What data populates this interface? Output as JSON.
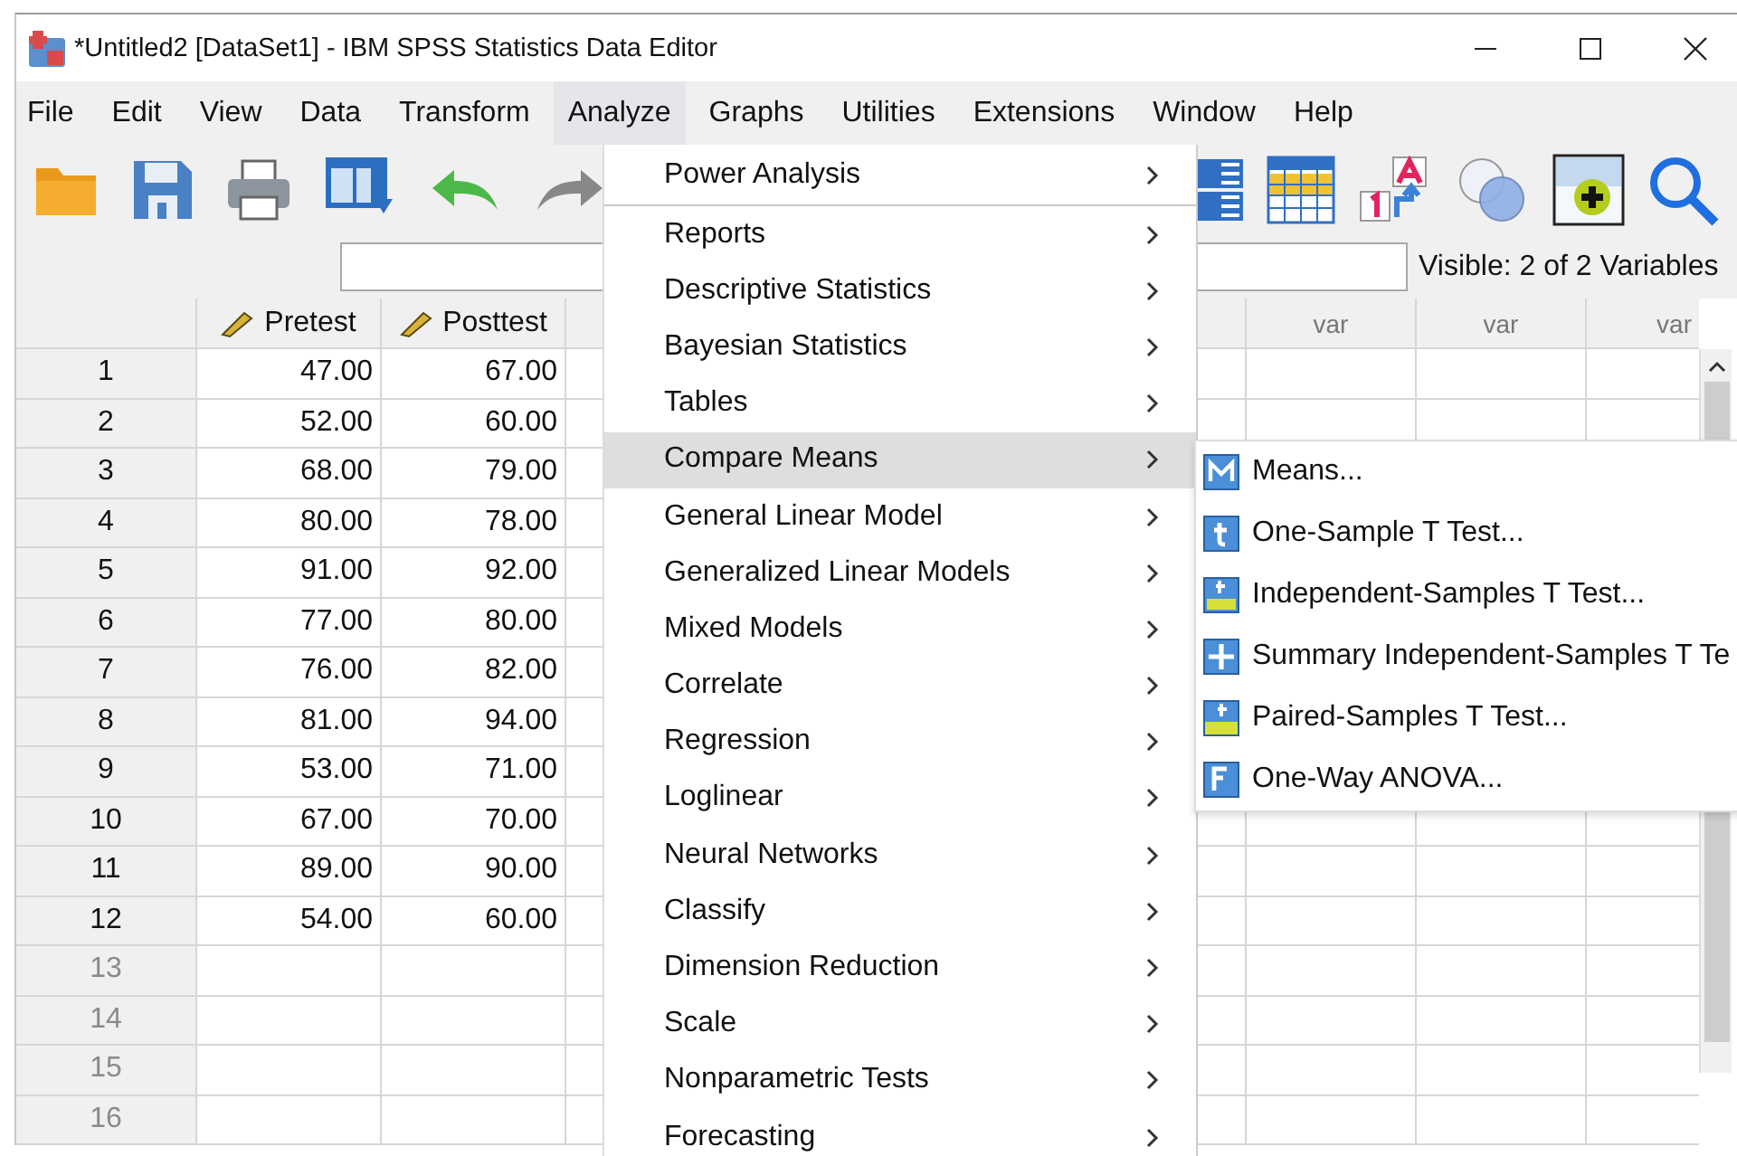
{
  "window": {
    "title": "*Untitled2 [DataSet1] - IBM SPSS Statistics Data Editor"
  },
  "menu_bar": [
    {
      "label": "File",
      "selected": false
    },
    {
      "label": "Edit",
      "selected": false
    },
    {
      "label": "View",
      "selected": false
    },
    {
      "label": "Data",
      "selected": false
    },
    {
      "label": "Transform",
      "selected": false
    },
    {
      "label": "Analyze",
      "selected": true
    },
    {
      "label": "Graphs",
      "selected": false
    },
    {
      "label": "Utilities",
      "selected": false
    },
    {
      "label": "Extensions",
      "selected": false
    },
    {
      "label": "Window",
      "selected": false
    },
    {
      "label": "Help",
      "selected": false
    }
  ],
  "variable_bar": {
    "status": "Visible: 2 of 2 Variables"
  },
  "grid": {
    "columns": [
      {
        "label": "Pretest"
      },
      {
        "label": "Posttest"
      }
    ],
    "var_columns": [
      "var",
      "var",
      "var"
    ],
    "rows": [
      {
        "number": "1",
        "values": [
          "47.00",
          "67.00"
        ]
      },
      {
        "number": "2",
        "values": [
          "52.00",
          "60.00"
        ]
      },
      {
        "number": "3",
        "values": [
          "68.00",
          "79.00"
        ]
      },
      {
        "number": "4",
        "values": [
          "80.00",
          "78.00"
        ]
      },
      {
        "number": "5",
        "values": [
          "91.00",
          "92.00"
        ]
      },
      {
        "number": "6",
        "values": [
          "77.00",
          "80.00"
        ]
      },
      {
        "number": "7",
        "values": [
          "76.00",
          "82.00"
        ]
      },
      {
        "number": "8",
        "values": [
          "81.00",
          "94.00"
        ]
      },
      {
        "number": "9",
        "values": [
          "53.00",
          "71.00"
        ]
      },
      {
        "number": "10",
        "values": [
          "67.00",
          "70.00"
        ]
      },
      {
        "number": "11",
        "values": [
          "89.00",
          "90.00"
        ]
      },
      {
        "number": "12",
        "values": [
          "54.00",
          "60.00"
        ]
      },
      {
        "number": "13"
      },
      {
        "number": "14"
      },
      {
        "number": "15"
      },
      {
        "number": "16"
      }
    ]
  },
  "analyze_menu": {
    "items": [
      {
        "label": "Power Analysis",
        "selected": false,
        "separator_after": true
      },
      {
        "label": "Reports",
        "selected": false,
        "separator_after": false
      },
      {
        "label": "Descriptive Statistics",
        "selected": false,
        "separator_after": false
      },
      {
        "label": "Bayesian Statistics",
        "selected": false,
        "separator_after": false
      },
      {
        "label": "Tables",
        "selected": false,
        "separator_after": false
      },
      {
        "label": "Compare Means",
        "selected": true,
        "separator_after": false
      },
      {
        "label": "General Linear Model",
        "selected": false,
        "separator_after": false
      },
      {
        "label": "Generalized Linear Models",
        "selected": false,
        "separator_after": false
      },
      {
        "label": "Mixed Models",
        "selected": false,
        "separator_after": false
      },
      {
        "label": "Correlate",
        "selected": false,
        "separator_after": false
      },
      {
        "label": "Regression",
        "selected": false,
        "separator_after": false
      },
      {
        "label": "Loglinear",
        "selected": false,
        "separator_after": false
      },
      {
        "label": "Neural Networks",
        "selected": false,
        "separator_after": false
      },
      {
        "label": "Classify",
        "selected": false,
        "separator_after": false
      },
      {
        "label": "Dimension Reduction",
        "selected": false,
        "separator_after": false
      },
      {
        "label": "Scale",
        "selected": false,
        "separator_after": false
      },
      {
        "label": "Nonparametric Tests",
        "selected": false,
        "separator_after": false
      },
      {
        "label": "Forecasting",
        "selected": false,
        "separator_after": false
      }
    ]
  },
  "compare_means_submenu": {
    "items": [
      {
        "label": "Means...",
        "kind": "means"
      },
      {
        "label": "One-Sample T Test...",
        "kind": "t"
      },
      {
        "label": "Independent-Samples T Test...",
        "kind": "t-groups"
      },
      {
        "label": "Summary Independent-Samples T Te",
        "kind": "plus"
      },
      {
        "label": "Paired-Samples T Test...",
        "kind": "t-paired"
      },
      {
        "label": "One-Way ANOVA...",
        "kind": "f"
      }
    ]
  }
}
